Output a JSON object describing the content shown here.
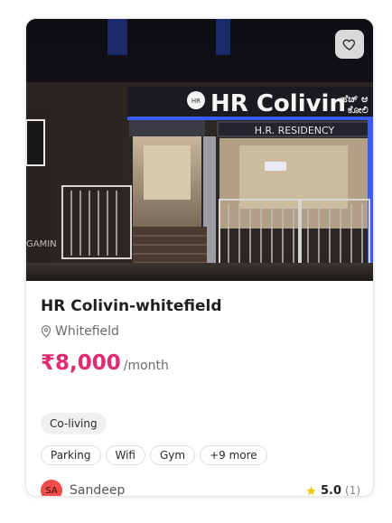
{
  "listing": {
    "photo": {
      "sign_text": "HR Colivin",
      "sign_logo_text": "HR",
      "sign_regional_text_1": "ಹೆಚ್ ಆ",
      "sign_regional_text_2": "ಕೋಲಿ",
      "residency_text": "H.R. RESIDENCY",
      "side_text": "GAMIN"
    },
    "favorite_icon": "heart-outline-icon",
    "title": "HR Colivin-whitefield",
    "location_icon": "location-pin-icon",
    "location": "Whitefield",
    "price": "₹8,000",
    "price_period": "/month",
    "type_badge": "Co-living",
    "amenities": [
      "Parking",
      "Wifi",
      "Gym",
      "+9 more"
    ],
    "host": {
      "initials": "SA",
      "name": "Sandeep"
    },
    "rating": {
      "star_icon": "star-icon",
      "value": "5.0",
      "count": "(1)"
    }
  },
  "colors": {
    "price": "#e0296f",
    "avatar": "#f24b4b",
    "star": "#f5c518",
    "sign_glow": "#3b5bff"
  }
}
